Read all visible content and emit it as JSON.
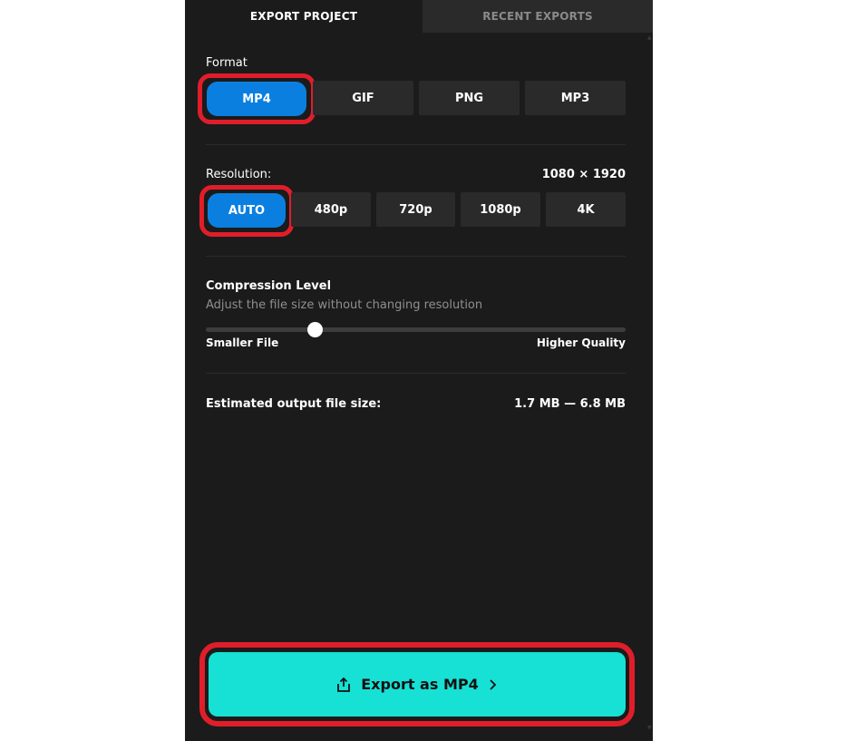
{
  "tabs": {
    "export_project": "EXPORT PROJECT",
    "recent_exports": "RECENT EXPORTS"
  },
  "format": {
    "label": "Format",
    "options": [
      "MP4",
      "GIF",
      "PNG",
      "MP3"
    ],
    "selected": "MP4"
  },
  "resolution": {
    "label": "Resolution:",
    "dimensions": "1080 × 1920",
    "options": [
      "AUTO",
      "480p",
      "720p",
      "1080p",
      "4K"
    ],
    "selected": "AUTO"
  },
  "compression": {
    "label": "Compression Level",
    "description": "Adjust the file size without changing resolution",
    "min_label": "Smaller File",
    "max_label": "Higher Quality",
    "level_fraction": 0.26
  },
  "estimate": {
    "label": "Estimated output file size:",
    "value": "1.7 MB — 6.8 MB"
  },
  "export_button": {
    "label": "Export as MP4",
    "icon": "share-export-icon",
    "chevron": "chevron-right-icon"
  },
  "colors": {
    "panel_bg": "#1b1b1b",
    "selected_blue": "#0b7fe0",
    "export_cyan": "#17e0d5",
    "highlight_red": "#e01e2a"
  }
}
